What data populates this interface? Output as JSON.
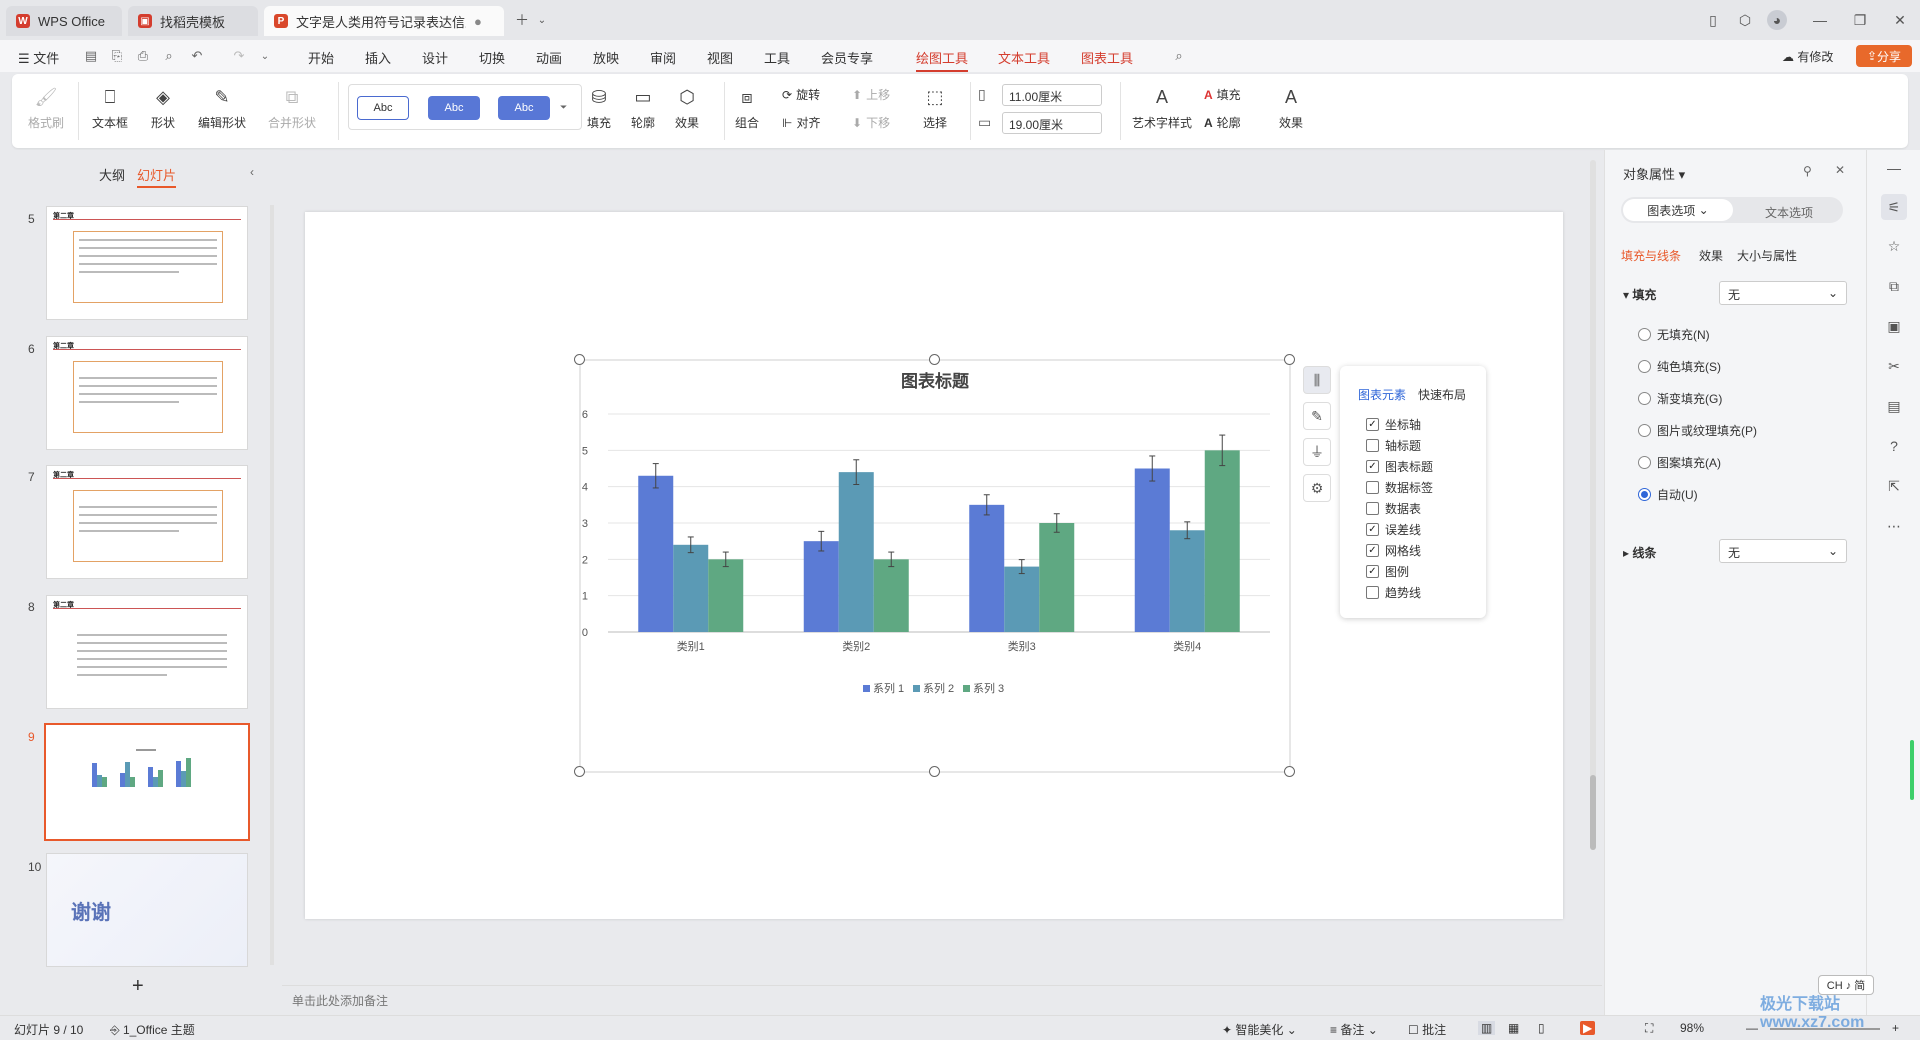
{
  "tabs": [
    {
      "label": "WPS Office"
    },
    {
      "label": "找稻壳模板"
    },
    {
      "label": "文字是人类用符号记录表达信息以"
    }
  ],
  "menu": {
    "file": "文件",
    "items": [
      "开始",
      "插入",
      "设计",
      "切换",
      "动画",
      "放映",
      "审阅",
      "视图",
      "工具",
      "会员专享"
    ],
    "context": [
      "绘图工具",
      "文本工具",
      "图表工具"
    ],
    "modified": "有修改",
    "share": "分享"
  },
  "ribbon": {
    "format_painter": "格式刷",
    "textbox": "文本框",
    "shape": "形状",
    "edit_shape": "编辑形状",
    "merge_shape": "合并形状",
    "style_sample": "Abc",
    "fill": "填充",
    "outline": "轮廓",
    "effect": "效果",
    "combine": "组合",
    "rotate": "旋转",
    "align": "对齐",
    "move_up": "上移",
    "move_down": "下移",
    "select": "选择",
    "height": "11.00厘米",
    "width": "19.00厘米",
    "art_text": "艺术字样式",
    "text_fill": "填充",
    "text_outline": "轮廓",
    "text_effect": "效果"
  },
  "leftpanel": {
    "outline_tab": "大纲",
    "slides_tab": "幻灯片",
    "thumb_title": "第二章",
    "thanks": "谢谢",
    "numbers": [
      "5",
      "6",
      "7",
      "8",
      "9",
      "10"
    ]
  },
  "chart_data": {
    "type": "bar",
    "title": "图表标题",
    "categories": [
      "类别1",
      "类别2",
      "类别3",
      "类别4"
    ],
    "series": [
      {
        "name": "系列 1",
        "values": [
          4.3,
          2.5,
          3.5,
          4.5
        ],
        "color": "#5b7bd5"
      },
      {
        "name": "系列 2",
        "values": [
          2.4,
          4.4,
          1.8,
          2.8
        ],
        "color": "#5b9ab5"
      },
      {
        "name": "系列 3",
        "values": [
          2.0,
          2.0,
          3.0,
          5.0
        ],
        "color": "#5fa882"
      }
    ],
    "ylim": [
      0,
      6
    ],
    "yticks": [
      "0",
      "1",
      "2",
      "3",
      "4",
      "5",
      "6"
    ],
    "error_bars": true,
    "grid": true,
    "legend": "bottom"
  },
  "popup": {
    "tab_elements": "图表元素",
    "tab_layout": "快速布局",
    "items": [
      {
        "label": "坐标轴",
        "checked": true
      },
      {
        "label": "轴标题",
        "checked": false
      },
      {
        "label": "图表标题",
        "checked": true
      },
      {
        "label": "数据标签",
        "checked": false
      },
      {
        "label": "数据表",
        "checked": false
      },
      {
        "label": "误差线",
        "checked": true
      },
      {
        "label": "网格线",
        "checked": true
      },
      {
        "label": "图例",
        "checked": true
      },
      {
        "label": "趋势线",
        "checked": false
      }
    ]
  },
  "rightpanel": {
    "title": "对象属性",
    "tab_chart": "图表选项",
    "tab_text": "文本选项",
    "sub_fill_line": "填充与线条",
    "sub_effect": "效果",
    "sub_size": "大小与属性",
    "fill_label": "填充",
    "fill_value": "无",
    "options": [
      "无填充(N)",
      "纯色填充(S)",
      "渐变填充(G)",
      "图片或纹理填充(P)",
      "图案填充(A)",
      "自动(U)"
    ],
    "selected_option": 5,
    "line_label": "线条",
    "line_value": "无"
  },
  "notes_placeholder": "单击此处添加备注",
  "status": {
    "slide_info": "幻灯片 9 / 10",
    "theme": "1_Office 主题",
    "beautify": "智能美化",
    "notes": "备注",
    "comments": "批注",
    "zoom": "98%",
    "ime": "CH ♪ 简"
  },
  "watermark": "极光下载站 www.xz7.com"
}
